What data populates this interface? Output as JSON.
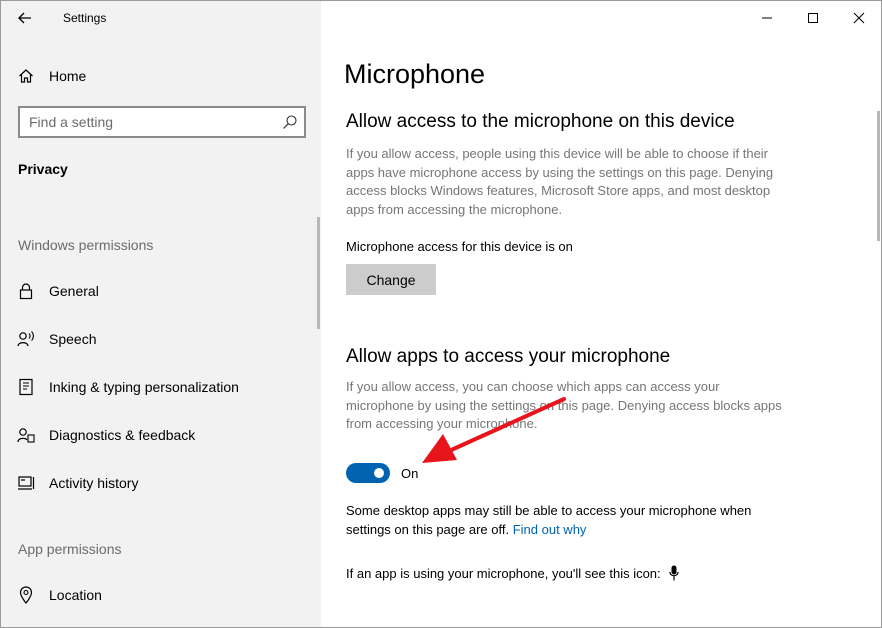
{
  "app": {
    "title": "Settings"
  },
  "sidebar": {
    "home_label": "Home",
    "search_placeholder": "Find a setting",
    "section_title": "Privacy",
    "windows_group": "Windows permissions",
    "windows_items": [
      {
        "label": "General",
        "icon": "lock-icon"
      },
      {
        "label": "Speech",
        "icon": "speech-icon"
      },
      {
        "label": "Inking & typing personalization",
        "icon": "inking-icon"
      },
      {
        "label": "Diagnostics & feedback",
        "icon": "diagnostics-icon"
      },
      {
        "label": "Activity history",
        "icon": "activity-history-icon"
      }
    ],
    "app_group": "App permissions",
    "app_items": [
      {
        "label": "Location",
        "icon": "location-icon"
      }
    ]
  },
  "content": {
    "page_title": "Microphone",
    "device_section": {
      "heading": "Allow access to the microphone on this device",
      "description": "If you allow access, people using this device will be able to choose if their apps have microphone access by using the settings on this page. Denying access blocks Windows features, Microsoft Store apps, and most desktop apps from accessing the microphone.",
      "status": "Microphone access for this device is on",
      "change_button": "Change"
    },
    "apps_section": {
      "heading": "Allow apps to access your microphone",
      "description": "If you allow access, you can choose which apps can access your microphone by using the settings on this page. Denying access blocks apps from accessing your microphone.",
      "toggle_on": true,
      "toggle_label": "On",
      "note": "Some desktop apps may still be able to access your microphone when settings on this page are off.",
      "link": "Find out why",
      "icon_note": "If an app is using your microphone, you'll see this icon:"
    }
  },
  "colors": {
    "accent": "#0063b1",
    "sidebar_bg": "#f2f2f2",
    "secondary_text": "#767676",
    "annotation_arrow": "#e8141b"
  }
}
